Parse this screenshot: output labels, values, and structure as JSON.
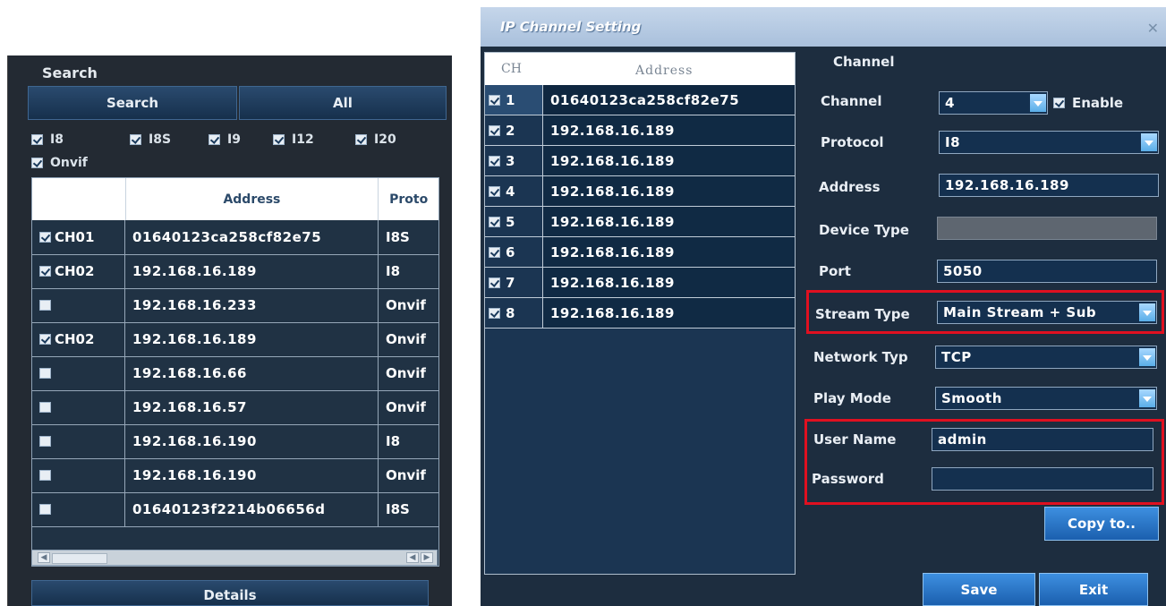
{
  "search_panel": {
    "title": "Search",
    "search_button": "Search",
    "all_button": "All",
    "protocol_filters": [
      {
        "label": "I8",
        "checked": true
      },
      {
        "label": "I8S",
        "checked": true
      },
      {
        "label": "I9",
        "checked": true
      },
      {
        "label": "I12",
        "checked": true
      },
      {
        "label": "I20",
        "checked": true
      },
      {
        "label": "Onvif",
        "checked": true
      }
    ],
    "table": {
      "columns": [
        "",
        "Address",
        "Proto"
      ],
      "rows": [
        {
          "checked": true,
          "ch": "CH01",
          "address": "01640123ca258cf82e75",
          "protocol": "I8S"
        },
        {
          "checked": true,
          "ch": "CH02",
          "address": "192.168.16.189",
          "protocol": "I8"
        },
        {
          "checked": false,
          "ch": "",
          "address": "192.168.16.233",
          "protocol": "Onvif"
        },
        {
          "checked": true,
          "ch": "CH02",
          "address": "192.168.16.189",
          "protocol": "Onvif"
        },
        {
          "checked": false,
          "ch": "",
          "address": "192.168.16.66",
          "protocol": "Onvif"
        },
        {
          "checked": false,
          "ch": "",
          "address": "192.168.16.57",
          "protocol": "Onvif"
        },
        {
          "checked": false,
          "ch": "",
          "address": "192.168.16.190",
          "protocol": "I8"
        },
        {
          "checked": false,
          "ch": "",
          "address": "192.168.16.190",
          "protocol": "Onvif"
        },
        {
          "checked": false,
          "ch": "",
          "address": "01640123f2214b06656d",
          "protocol": "I8S"
        }
      ]
    },
    "details_button": "Details"
  },
  "ip_channel_setting": {
    "title": "IP Channel Setting",
    "list": {
      "columns": [
        "CH",
        "Address"
      ],
      "rows": [
        {
          "ch": "1",
          "address": "01640123ca258cf82e75",
          "checked": true
        },
        {
          "ch": "2",
          "address": "192.168.16.189",
          "checked": true
        },
        {
          "ch": "3",
          "address": "192.168.16.189",
          "checked": true
        },
        {
          "ch": "4",
          "address": "192.168.16.189",
          "checked": true
        },
        {
          "ch": "5",
          "address": "192.168.16.189",
          "checked": true
        },
        {
          "ch": "6",
          "address": "192.168.16.189",
          "checked": true
        },
        {
          "ch": "7",
          "address": "192.168.16.189",
          "checked": true
        },
        {
          "ch": "8",
          "address": "192.168.16.189",
          "checked": true
        }
      ]
    },
    "form": {
      "group_title": "Channel",
      "channel_label": "Channel",
      "channel_value": "4",
      "enable_label": "Enable",
      "enable_checked": true,
      "protocol_label": "Protocol",
      "protocol_value": "I8",
      "address_label": "Address",
      "address_value": "192.168.16.189",
      "device_type_label": "Device Type",
      "device_type_value": "",
      "port_label": "Port",
      "port_value": "5050",
      "stream_type_label": "Stream Type",
      "stream_type_value": "Main Stream + Sub",
      "network_type_label": "Network Typ",
      "network_type_value": "TCP",
      "play_mode_label": "Play Mode",
      "play_mode_value": "Smooth",
      "user_name_label": "User Name",
      "user_name_value": "admin",
      "password_label": "Password",
      "password_value": ""
    },
    "copy_button": "Copy to..",
    "save_button": "Save",
    "exit_button": "Exit",
    "colors": {
      "highlight": "#e01020",
      "accent": "#3d8fe0"
    }
  }
}
